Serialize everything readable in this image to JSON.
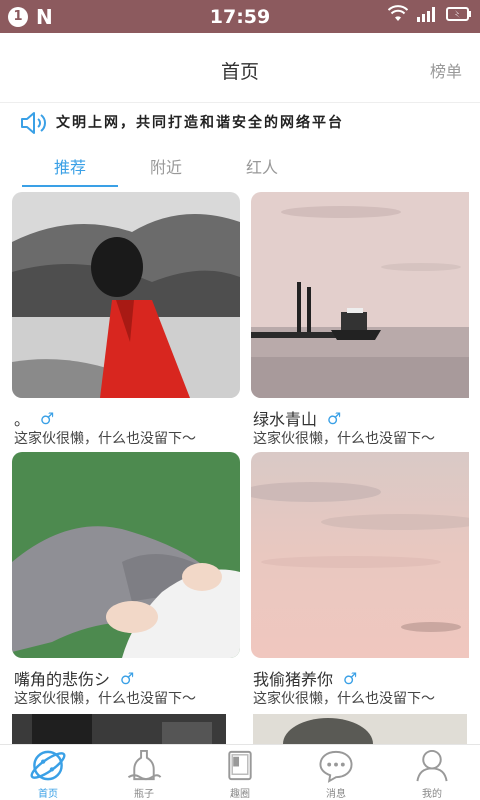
{
  "status_bar": {
    "notif_count": "1",
    "notif_letter": "N",
    "time": "17:59"
  },
  "header": {
    "title": "首页",
    "rank_label": "榜单"
  },
  "notice": {
    "text": "文明上网，共同打造和谐安全的网络平台"
  },
  "tabs": [
    {
      "label": "推荐",
      "active": true
    },
    {
      "label": "附近"
    },
    {
      "label": "红人"
    }
  ],
  "cards": [
    {
      "name": "。",
      "gender": "♂",
      "desc": "这家伙很懒，什么也没留下～"
    },
    {
      "name": "绿水青山",
      "gender": "♂",
      "desc": "这家伙很懒，什么也没留下～"
    },
    {
      "name": "嘴角的悲伤シ",
      "gender": "♂",
      "desc": "这家伙很懒，什么也没留下～"
    },
    {
      "name": "我偷猪养你",
      "gender": "♂",
      "desc": "这家伙很懒，什么也没留下～"
    }
  ],
  "bottom_nav": [
    {
      "label": "首页",
      "icon": "planet-icon",
      "active": true
    },
    {
      "label": "瓶子",
      "icon": "bottle-icon"
    },
    {
      "label": "趣圈",
      "icon": "book-icon"
    },
    {
      "label": "消息",
      "icon": "chat-bubble-icon"
    },
    {
      "label": "我的",
      "icon": "person-icon"
    }
  ],
  "colors": {
    "accent": "#3aa0e6",
    "status_bar": "#8c5a5e"
  }
}
